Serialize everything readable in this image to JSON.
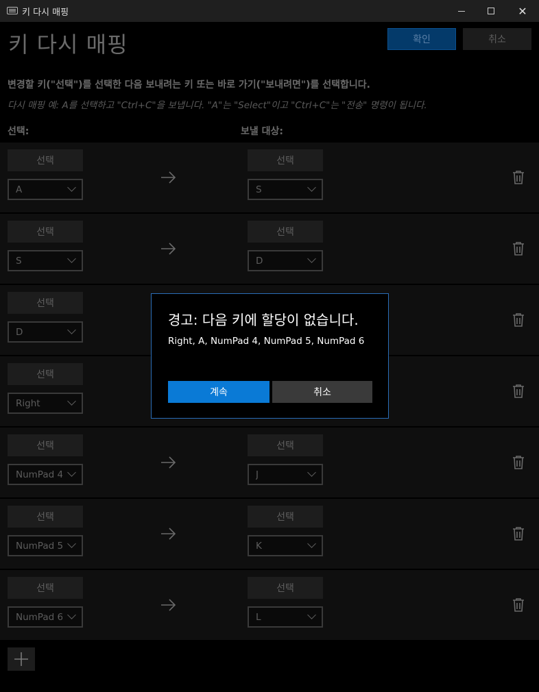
{
  "window": {
    "title": "키 다시 매핑",
    "icon": "keyboard-icon"
  },
  "header": {
    "heading": "키 다시 매핑",
    "ok_label": "확인",
    "cancel_label": "취소"
  },
  "instructions": {
    "main": "변경할 키(\"선택\")를 선택한 다음 보내려는 키 또는 바로 가기(\"보내려면\")를 선택합니다.",
    "example": "다시 매핑 예: A를 선택하고 \"Ctrl+C\"을 보냅니다. \"A\"는 \"Select\"이고 \"Ctrl+C\"는 \"전송\" 명령이 됩니다."
  },
  "columns": {
    "select": "선택:",
    "send_to": "보낼 대상:"
  },
  "rows": [
    {
      "pick_label": "선택",
      "from": "A",
      "pick_label_target": "선택",
      "to": "S"
    },
    {
      "pick_label": "선택",
      "from": "S",
      "pick_label_target": "선택",
      "to": "D"
    },
    {
      "pick_label": "선택",
      "from": "D",
      "pick_label_target": "선택",
      "to": ""
    },
    {
      "pick_label": "선택",
      "from": "Right",
      "pick_label_target": "선택",
      "to": ""
    },
    {
      "pick_label": "선택",
      "from": "NumPad 4",
      "pick_label_target": "선택",
      "to": "J"
    },
    {
      "pick_label": "선택",
      "from": "NumPad 5",
      "pick_label_target": "선택",
      "to": "K"
    },
    {
      "pick_label": "선택",
      "from": "NumPad 6",
      "pick_label_target": "선택",
      "to": "L"
    }
  ],
  "dialog": {
    "title": "경고: 다음 키에 할당이 없습니다.",
    "message": "Right, A, NumPad 4, NumPad 5, NumPad 6",
    "continue_label": "계속",
    "cancel_label": "취소"
  },
  "colors": {
    "accent": "#0a7ad6",
    "dialog_border": "#2a6db8",
    "row_bg": "#0f0f0f"
  }
}
